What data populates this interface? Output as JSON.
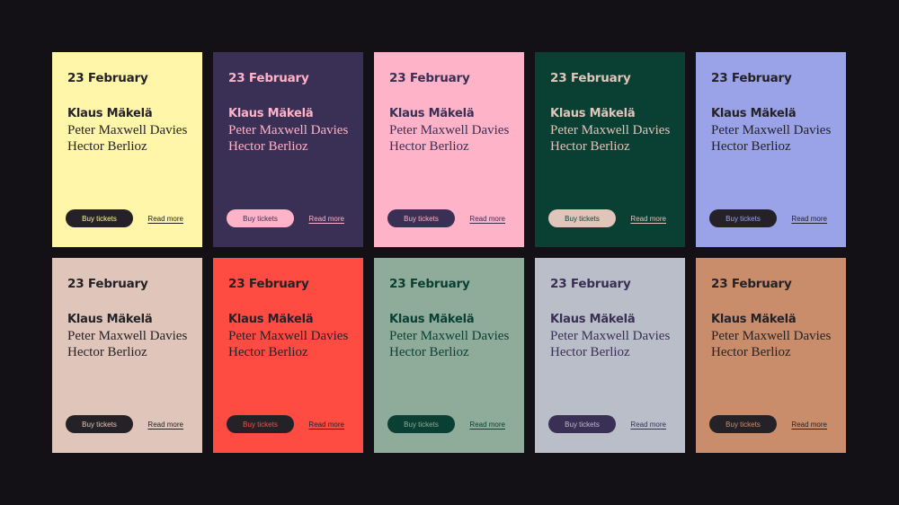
{
  "cards": [
    {
      "date": "23 February",
      "conductor": "Klaus Mäkelä",
      "composers": [
        "Peter Maxwell Davies",
        "Hector Berlioz"
      ],
      "buy_label": "Buy tickets",
      "read_label": "Read more",
      "colors": {
        "bg": "#fff6a9",
        "text": "#252227",
        "btn_bg": "#252227",
        "btn_text": "#fff6a9"
      }
    },
    {
      "date": "23 February",
      "conductor": "Klaus Mäkelä",
      "composers": [
        "Peter Maxwell Davies",
        "Hector Berlioz"
      ],
      "buy_label": "Buy tickets",
      "read_label": "Read more",
      "colors": {
        "bg": "#3a2f54",
        "text": "#ffb3c8",
        "btn_bg": "#ffb3c8",
        "btn_text": "#3a2f54"
      }
    },
    {
      "date": "23 February",
      "conductor": "Klaus Mäkelä",
      "composers": [
        "Peter Maxwell Davies",
        "Hector Berlioz"
      ],
      "buy_label": "Buy tickets",
      "read_label": "Read more",
      "colors": {
        "bg": "#ffb3c8",
        "text": "#3a2f54",
        "btn_bg": "#3a2f54",
        "btn_text": "#ffb3c8"
      }
    },
    {
      "date": "23 February",
      "conductor": "Klaus Mäkelä",
      "composers": [
        "Peter Maxwell Davies",
        "Hector Berlioz"
      ],
      "buy_label": "Buy tickets",
      "read_label": "Read more",
      "colors": {
        "bg": "#0a3f34",
        "text": "#e0c6ba",
        "btn_bg": "#e0c6ba",
        "btn_text": "#0a3f34"
      }
    },
    {
      "date": "23 February",
      "conductor": "Klaus Mäkelä",
      "composers": [
        "Peter Maxwell Davies",
        "Hector Berlioz"
      ],
      "buy_label": "Buy tickets",
      "read_label": "Read more",
      "colors": {
        "bg": "#9aa3e8",
        "text": "#252227",
        "btn_bg": "#252227",
        "btn_text": "#9aa3e8"
      }
    },
    {
      "date": "23 February",
      "conductor": "Klaus Mäkelä",
      "composers": [
        "Peter Maxwell Davies",
        "Hector Berlioz"
      ],
      "buy_label": "Buy tickets",
      "read_label": "Read more",
      "colors": {
        "bg": "#e0c6ba",
        "text": "#252227",
        "btn_bg": "#252227",
        "btn_text": "#e0c6ba"
      }
    },
    {
      "date": "23 February",
      "conductor": "Klaus Mäkelä",
      "composers": [
        "Peter Maxwell Davies",
        "Hector Berlioz"
      ],
      "buy_label": "Buy tickets",
      "read_label": "Read more",
      "colors": {
        "bg": "#ff4c42",
        "text": "#252227",
        "btn_bg": "#252227",
        "btn_text": "#ff4c42"
      }
    },
    {
      "date": "23 February",
      "conductor": "Klaus Mäkelä",
      "composers": [
        "Peter Maxwell Davies",
        "Hector Berlioz"
      ],
      "buy_label": "Buy tickets",
      "read_label": "Read more",
      "colors": {
        "bg": "#8fab99",
        "text": "#0a3f34",
        "btn_bg": "#0a3f34",
        "btn_text": "#8fab99"
      }
    },
    {
      "date": "23 February",
      "conductor": "Klaus Mäkelä",
      "composers": [
        "Peter Maxwell Davies",
        "Hector Berlioz"
      ],
      "buy_label": "Buy tickets",
      "read_label": "Read more",
      "colors": {
        "bg": "#b9bec8",
        "text": "#3a2f54",
        "btn_bg": "#3a2f54",
        "btn_text": "#b9bec8"
      }
    },
    {
      "date": "23 February",
      "conductor": "Klaus Mäkelä",
      "composers": [
        "Peter Maxwell Davies",
        "Hector Berlioz"
      ],
      "buy_label": "Buy tickets",
      "read_label": "Read more",
      "colors": {
        "bg": "#c98d6c",
        "text": "#252227",
        "btn_bg": "#252227",
        "btn_text": "#c98d6c"
      }
    }
  ]
}
